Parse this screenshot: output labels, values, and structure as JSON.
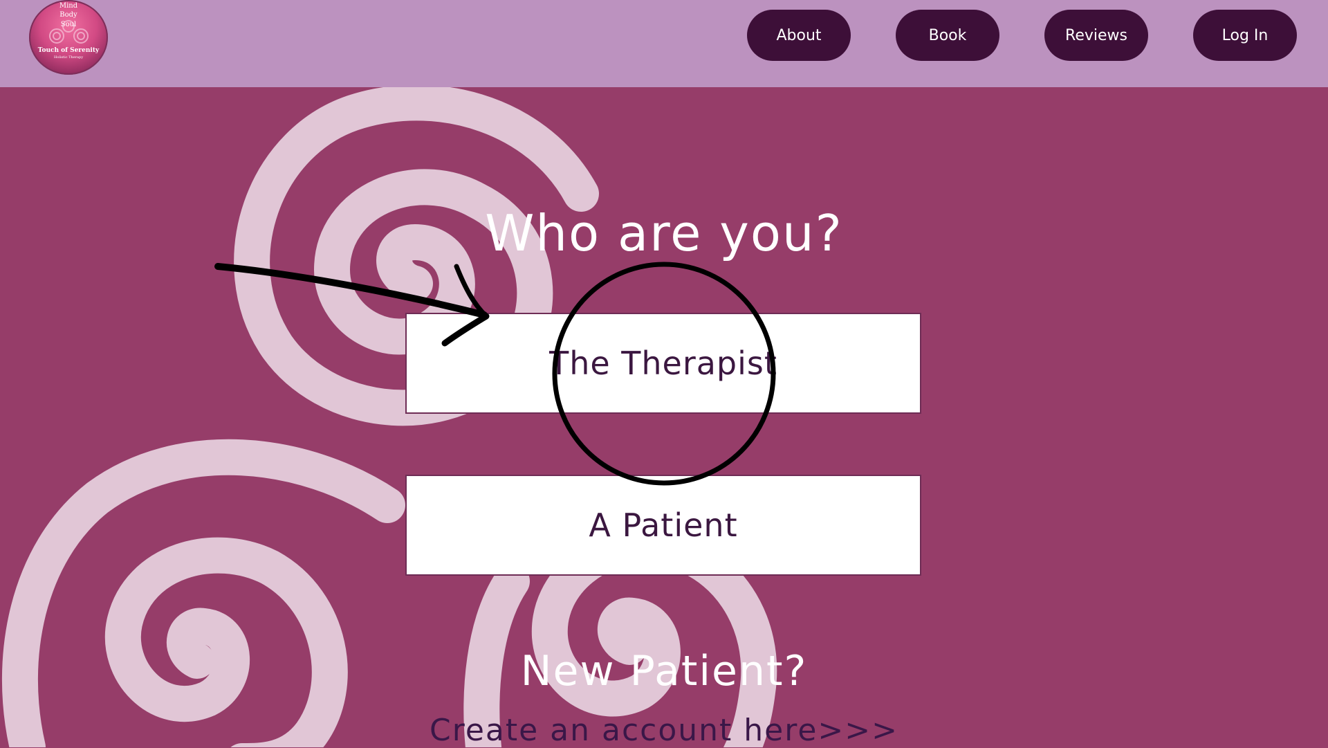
{
  "header": {
    "logo": {
      "line1": "Mind",
      "line2": "Body",
      "line3": "Soul",
      "line4": "Touch of Serenity",
      "line5": "Holistic Therapy",
      "line6": ""
    },
    "nav": [
      "About",
      "Book",
      "Reviews",
      "Log In"
    ]
  },
  "main": {
    "title": "Who are you?",
    "options": [
      "The Therapist",
      "A Patient"
    ],
    "new_patient_heading": "New Patient?",
    "create_account_link": "Create an account here>>>"
  },
  "colors": {
    "page_background": "#963d69",
    "header_background": "#bc92bf",
    "nav_button": "#3d0f38",
    "spiral": "#e1c6d6",
    "option_text": "#3b1740"
  },
  "annotations": {
    "arrow_icon": "hand-drawn-arrow-icon",
    "circle_icon": "hand-drawn-circle-icon"
  }
}
